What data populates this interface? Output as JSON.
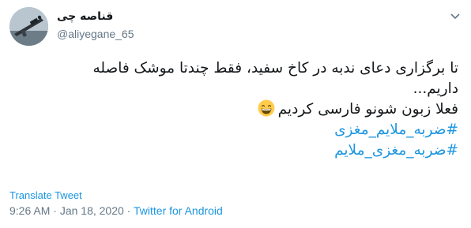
{
  "author": {
    "display_name": "قناصه چی",
    "handle": "@aliyegane_65"
  },
  "tweet": {
    "text_line_1": "تا برگزاری دعای ندبه در کاخ سفید، فقط چندتا موشک فاصله",
    "text_line_2": "داریم...",
    "text_line_3": "فعلا زبون شونو فارسی کردیم",
    "emoji": "grinning-face-with-smiling-eyes",
    "hashtags": [
      "#ضربه_ملایم_مغزی",
      "#ضربه_مغزی_ملایم"
    ]
  },
  "actions": {
    "translate_label": "Translate Tweet"
  },
  "meta": {
    "time": "9:26 AM",
    "separator_1": " · ",
    "date": "Jan 18, 2020",
    "separator_2": " · ",
    "source": "Twitter for Android"
  },
  "colors": {
    "link": "#1b95e0",
    "secondary_text": "#657786",
    "primary_text": "#14171a"
  },
  "icons": {
    "menu": "chevron-down-icon",
    "avatar": "avatar"
  }
}
